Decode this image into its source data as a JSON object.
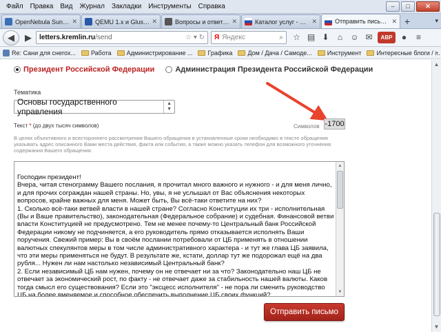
{
  "menubar": {
    "items": [
      "Файл",
      "Правка",
      "Вид",
      "Журнал",
      "Закладки",
      "Инструменты",
      "Справка"
    ]
  },
  "window_controls": {
    "minimize": "–",
    "maximize": "□",
    "close": "✕"
  },
  "tabs": [
    {
      "label": "OpenNebula Sunstone...",
      "favicon_color": "#3b6fb6"
    },
    {
      "label": "QEMU 1.x и GlusterFS 3.4...",
      "favicon_color": "#2a58a8"
    },
    {
      "label": "Вопросы и ответы по...",
      "favicon_color": "#555555"
    },
    {
      "label": "Каталог услуг - Порт...",
      "favicon_color": "#c8232c"
    },
    {
      "label": "Отправить письмо П...",
      "favicon_color": "#c8232c",
      "active": true
    }
  ],
  "navbar": {
    "url_domain": "letters.kremlin.ru",
    "url_path": "/send",
    "search_engine": "Я",
    "search_placeholder": "Яндекс"
  },
  "bookmarks": [
    {
      "label": "Re: Сани для снегох...",
      "type": "page"
    },
    {
      "label": "Работа",
      "type": "folder"
    },
    {
      "label": "Администрирование ...",
      "type": "folder"
    },
    {
      "label": "Графика",
      "type": "folder"
    },
    {
      "label": "Дом / Дача / Самоде...",
      "type": "folder"
    },
    {
      "label": "Инструмент",
      "type": "folder"
    },
    {
      "label": "Интересные блоги / ...",
      "type": "folder"
    }
  ],
  "form": {
    "recipient_options": [
      {
        "label": "Президент Российской Федерации",
        "checked": true
      },
      {
        "label": "Администрация Президента Российской Федерации",
        "checked": false
      }
    ],
    "topic_label": "Тематика",
    "topic_value": "Основы государственного управления",
    "text_label": "Текст",
    "text_required_mark": "*",
    "text_limit_note": "(до двух тысяч символов)",
    "counter_label": "Символов",
    "counter_value": "-1700",
    "hint": "В целях объективного и всестороннего рассмотрения Вашего обращения в установленные сроки необходимо в тексте обращения указывать адрес описанного Вами места действия, факта или события, а также можно указать телефон для возможного уточнения содержания Вашего обращения.",
    "message_text": "Господин президент!\nВчера, читая стенограмму Вашего послания, я прочитал много важного и нужного - и для меня лично, и для прочих сограждан нашей страны. Но, увы, я не услышал от Вас объяснения некоторых вопросов, крайне важных для меня. Может быть, Вы всё-таки ответите на них?\n1. Сколько всё-таки ветвей власти в нашей стране? Согласно Конституции их три - исполнительная (Вы и Ваше правительство), законодательная (Федеральное собрание) и судебная. Финансовой ветви власти Конституцией не предусмотрено. Тем не менее почему-то Центральный банк Российской Федерации никому не подчиняется, а его руководитель прямо отказывается исполнять Ваши поручения. Свежий пример: Вы в своём послании потребовали от ЦБ применять в отношении валютных спекулянтов меры в том числе административного характера - и тут же глава ЦБ заявила, что эти меры применяться не будут. В результате же, кстати, доллар тут же подорожал ещё на два рубля... Нужен ли нам настолько независимый Центральный банк?\n2. Если независимый ЦБ нам нужен, почему он не отвечает ни за что? Законодательно наш ЦБ не отвечает за экономический рост, по факту - не отвечает даже за стабильность нашей валюты. Каков тогда смысл его существования? Если это \"эксцесс исполнителя\" - не пора ли сменить руководство ЦБ на более вменяемое и способное обеспечить выполнение ЦБ своих функций?",
    "submit_label": "Отправить письмо"
  },
  "colors": {
    "accent_red": "#b22222",
    "button_red": "#c7392e",
    "annotation_arrow": "#e8432d"
  }
}
